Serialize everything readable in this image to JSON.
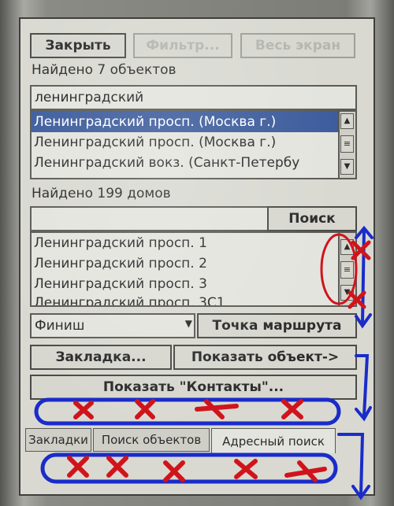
{
  "toolbar": {
    "close_label": "Закрыть",
    "filter_label": "Фильтр...",
    "fullscreen_label": "Весь экран"
  },
  "objects": {
    "found_text": "Найдено 7 объектов",
    "search_value": "ленинградский",
    "items": [
      "Ленинградский просп. (Москва г.)",
      "Ленинградский просп. (Москва г.)",
      "Ленинградский вокз. (Санкт-Петербу"
    ]
  },
  "houses": {
    "found_text": "Найдено 199 домов",
    "search_value": "",
    "search_button": "Поиск",
    "items": [
      "Ленинградский просп. 1",
      "Ленинградский просп. 2",
      "Ленинградский просп. 3",
      "Ленинградский просп. 3С1"
    ]
  },
  "route": {
    "point_type": "Финиш",
    "point_button": "Точка маршрута"
  },
  "actions": {
    "bookmark": "Закладка...",
    "show_object": "Показать объект->",
    "show_contacts": "Показать \"Контакты\"..."
  },
  "tabs": [
    {
      "label": "Закладки",
      "active": false
    },
    {
      "label": "Поиск объектов",
      "active": false
    },
    {
      "label": "Адресный поиск",
      "active": true
    }
  ],
  "colors": {
    "selection": "#3d5c9c",
    "annotation_blue": "#1a2cc8",
    "annotation_red": "#d0141c"
  }
}
